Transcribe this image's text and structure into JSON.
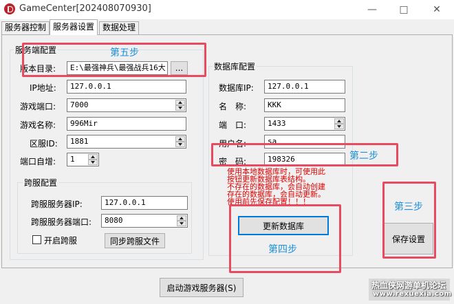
{
  "window": {
    "title": "GameCenter[202408070930]",
    "minimize_icon": "minimize-icon",
    "maximize_icon": "maximize-icon",
    "close_icon": "close-icon"
  },
  "tabs": [
    "服务器控制",
    "服务器设置",
    "数据处理"
  ],
  "server": {
    "group_title": "服务端配置",
    "version_dir_label": "版本目录:",
    "version_dir_value": "E:\\最强神兵\\最强战兵16大",
    "browse_label": "...",
    "ip_label": "IP地址:",
    "ip_value": "127.0.0.1",
    "port_label": "游戏端口:",
    "port_value": "7000",
    "name_label": "游戏名称:",
    "name_value": "996Mir",
    "zone_label": "区服ID:",
    "zone_value": "1881",
    "autoinc_label": "端口自增:",
    "autoinc_value": "1"
  },
  "cross": {
    "group_title": "跨服配置",
    "ip_label": "跨服服务器IP:",
    "ip_value": "127.0.0.1",
    "port_label": "跨服服务器端口:",
    "port_value": "8080",
    "enable_label": "开启跨服",
    "sync_label": "同步跨服文件"
  },
  "database": {
    "group_title": "数据库配置",
    "ip_label": "数据库IP:",
    "ip_value": "127.0.0.1",
    "name_label": "名　称:",
    "name_value": "KKK",
    "port_label": "端　口:",
    "port_value": "1433",
    "user_label": "用户名:",
    "user_value": "sa",
    "password_label": "密　码:",
    "password_value": "198326",
    "note_lines": [
      "使用本地数据库时，可使用此",
      "按钮更新数据库表结构。",
      "不存在的数据库，会自动创建",
      "存在的数据库，会自动更新。",
      "使用前先保存配置！！！"
    ],
    "update_button": "更新数据库"
  },
  "save_button": "保存设置",
  "start_button": "启动游戏服务器(S)",
  "steps": {
    "step5": "第五步",
    "step2": "第二步",
    "step3": "第三步",
    "step4": "第四步"
  },
  "watermark": {
    "line1": "热血侠网游单机论坛",
    "line2": "www.rexuexia.com"
  },
  "colors": {
    "highlight_box": "#e84a5f",
    "step_text": "#1e90d8",
    "note_text": "#e00000"
  }
}
